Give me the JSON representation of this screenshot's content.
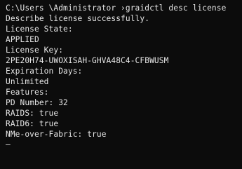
{
  "terminal": {
    "colors": {
      "background": "#0c0c0c",
      "foreground": "#e6e6e6"
    },
    "lines": [
      "C:\\Users \\Administrator ›graidctl desc license",
      "Describe license successfully.",
      "License State:",
      "APPLIED",
      "License Key:",
      "2PE20H74-UWOXISAH-GHVA48C4-CFBWUSM",
      "Expiration Days:",
      "Unlimited",
      "Features:",
      "PD Number: 32",
      "RAIDS: true",
      "RAID6: true",
      "NMe-over-Fabric: true",
      "—"
    ]
  }
}
